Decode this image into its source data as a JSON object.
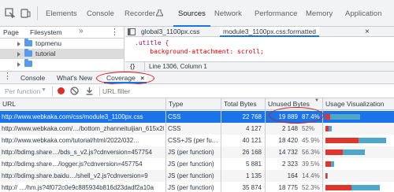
{
  "top_tabs": [
    "Elements",
    "Console",
    "Recorder",
    "Sources",
    "Network",
    "Performance",
    "Memory",
    "Application"
  ],
  "navigator": {
    "tabs": [
      "Page",
      "Filesystem"
    ],
    "folders": [
      "topmenu",
      "tutorial",
      ""
    ]
  },
  "editor": {
    "tabs": [
      "global3_1100px.css",
      "module3_1100px.css:formatted"
    ],
    "code": [
      ".utitle {",
      "    background-attachment: scroll;"
    ],
    "status": "Line 1306, Column 1",
    "status_icon": "{}"
  },
  "drawer": {
    "tabs": [
      "Console",
      "What's New",
      "Coverage"
    ],
    "close_glyph": "×"
  },
  "coverage": {
    "filter_select": "Per function",
    "url_filter_placeholder": "URL filter",
    "columns": [
      "URL",
      "Type",
      "Total Bytes",
      "Unused Bytes",
      "Usage Visualization"
    ],
    "rows": [
      {
        "url": "http://www.webkaka.com/css/module3_1100px.css",
        "type": "CSS",
        "total": "22 768",
        "unused": "19 889",
        "pct": "87.4%",
        "used_frac": 0.126,
        "size_frac": 0.52
      },
      {
        "url": "http://www.webkaka.com/…/bottom_zhanneituijian_615x205.html",
        "type": "CSS",
        "total": "4 127",
        "unused": "2 148",
        "pct": "52%",
        "used_frac": 0.48,
        "size_frac": 0.095
      },
      {
        "url": "http://www.webkaka.com/tutorial/html/2022/032…",
        "type": "CSS+JS (per fu…",
        "total": "40 121",
        "unused": "18 420",
        "pct": "45.9%",
        "used_frac": 0.541,
        "size_frac": 0.92
      },
      {
        "url": "http://bdimg.share…/bds_s_v2.js?cdnversion=457754",
        "type": "JS (per function)",
        "total": "26 168",
        "unused": "14 732",
        "pct": "56.3%",
        "used_frac": 0.437,
        "size_frac": 0.6
      },
      {
        "url": "http://bdimg.share…/logger.js?cdnversion=457754",
        "type": "JS (per function)",
        "total": "5 881",
        "unused": "2 323",
        "pct": "39.5%",
        "used_frac": 0.605,
        "size_frac": 0.135
      },
      {
        "url": "http://bdimg.share.baidu…/shell_v2.js?cdnversion=9",
        "type": "JS (per function)",
        "total": "1 135",
        "unused": "164",
        "pct": "14.4%",
        "used_frac": 0.856,
        "size_frac": 0.026
      },
      {
        "url": "http:// …/hm.js?4f072c0e9c885934b816d23dadf2a10a",
        "type": "JS (per function)",
        "total": "35 874",
        "unused": "18 775",
        "pct": "52.3%",
        "used_frac": 0.477,
        "size_frac": 0.82
      }
    ]
  },
  "colors": {
    "used": "#e0342d",
    "unused": "#4ea6c8",
    "selection": "#1a73e8",
    "annotation": "#d81b1b"
  }
}
